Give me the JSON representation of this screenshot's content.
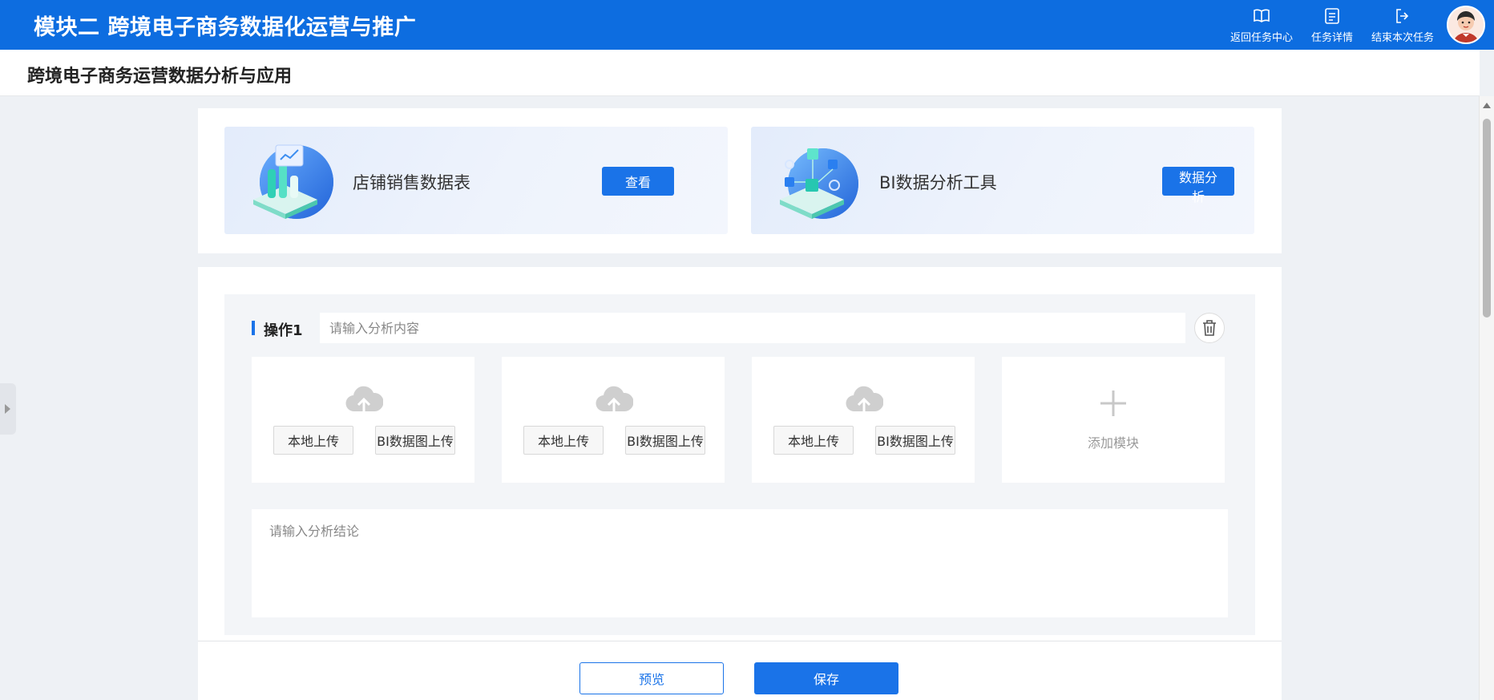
{
  "header": {
    "title": "模块二 跨境电子商务数据化运营与推广",
    "actions": [
      {
        "icon": "book-icon",
        "label": "返回任务中心"
      },
      {
        "icon": "task-list-icon",
        "label": "任务详情"
      },
      {
        "icon": "exit-icon",
        "label": "结束本次任务"
      }
    ]
  },
  "page": {
    "title": "跨境电子商务运营数据分析与应用"
  },
  "tools": [
    {
      "title": "店铺销售数据表",
      "button": "查看",
      "icon": "sales-data-illustration"
    },
    {
      "title": "BI数据分析工具",
      "button": "数据分析",
      "icon": "bi-tool-illustration"
    }
  ],
  "operation": {
    "label": "操作1",
    "input_placeholder": "请输入分析内容",
    "uploads": [
      {
        "local_label": "本地上传",
        "bi_label": "BI数据图上传"
      },
      {
        "local_label": "本地上传",
        "bi_label": "BI数据图上传"
      },
      {
        "local_label": "本地上传",
        "bi_label": "BI数据图上传"
      }
    ],
    "add_label": "添加模块",
    "conclusion_placeholder": "请输入分析结论"
  },
  "footer": {
    "preview_label": "预览",
    "save_label": "保存"
  },
  "colors": {
    "header_bg": "#0d6de0",
    "accent": "#1a73e8",
    "page_bg": "#eef1f5"
  }
}
